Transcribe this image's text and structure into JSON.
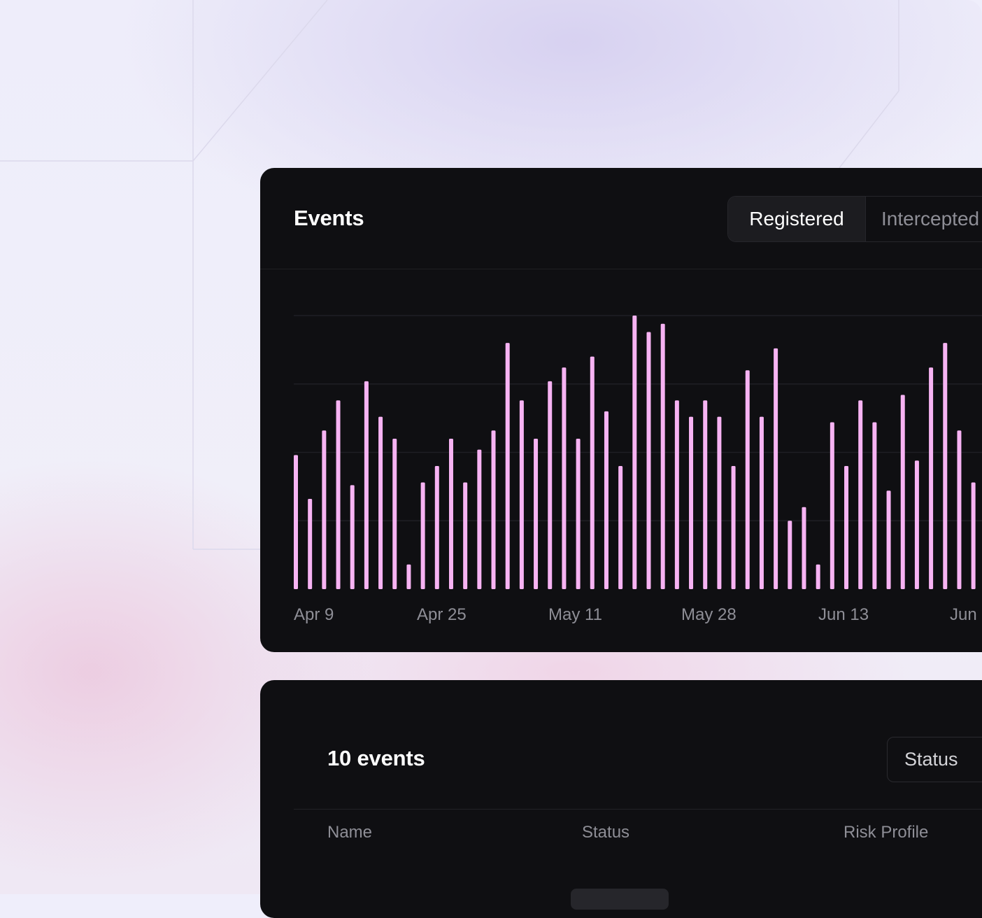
{
  "events_card": {
    "title": "Events",
    "tabs": [
      {
        "label": "Registered",
        "active": true
      },
      {
        "label": "Intercepted",
        "active": false
      }
    ]
  },
  "chart_data": {
    "type": "bar",
    "title": "",
    "xlabel": "",
    "ylabel": "",
    "bar_color": "#f7b3f3",
    "grid": true,
    "ylim": [
      0,
      100
    ],
    "x_tick_labels": [
      "Apr 9",
      "Apr 25",
      "May 11",
      "May 28",
      "Jun 13",
      "Jun"
    ],
    "values": [
      49,
      33,
      58,
      69,
      38,
      76,
      63,
      55,
      9,
      39,
      45,
      55,
      39,
      51,
      58,
      90,
      69,
      55,
      76,
      81,
      55,
      85,
      65,
      45,
      100,
      94,
      97,
      69,
      63,
      69,
      63,
      45,
      80,
      63,
      88,
      25,
      30,
      9,
      61,
      45,
      69,
      61,
      36,
      71,
      47,
      81,
      90,
      58,
      39
    ]
  },
  "events_table": {
    "title": "10 events",
    "filter_label": "Status",
    "columns": [
      "Name",
      "Status",
      "Risk Profile"
    ]
  }
}
